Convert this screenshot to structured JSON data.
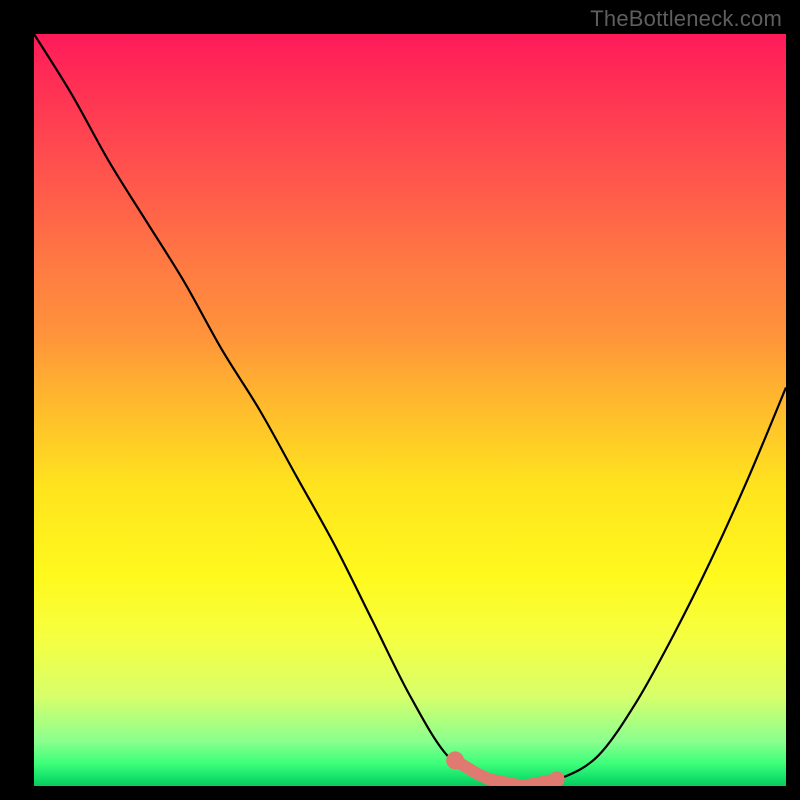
{
  "watermark": "TheBottleneck.com",
  "chart_data": {
    "type": "line",
    "title": "",
    "xlabel": "",
    "ylabel": "",
    "xlim": [
      0,
      100
    ],
    "ylim": [
      0,
      100
    ],
    "x": [
      0,
      5,
      10,
      15,
      20,
      25,
      30,
      35,
      40,
      45,
      50,
      55,
      60,
      65,
      70,
      75,
      80,
      85,
      90,
      95,
      100
    ],
    "values": [
      100,
      92,
      83,
      75,
      67,
      58,
      50,
      41,
      32,
      22,
      12,
      4,
      1,
      0,
      1,
      4,
      11,
      20,
      30,
      41,
      53
    ],
    "gradient_colors": [
      "#ff1a5a",
      "#ffe31e",
      "#12e06a"
    ],
    "marker_region": {
      "x_start": 56,
      "x_end": 70,
      "color": "#e07a70"
    }
  }
}
